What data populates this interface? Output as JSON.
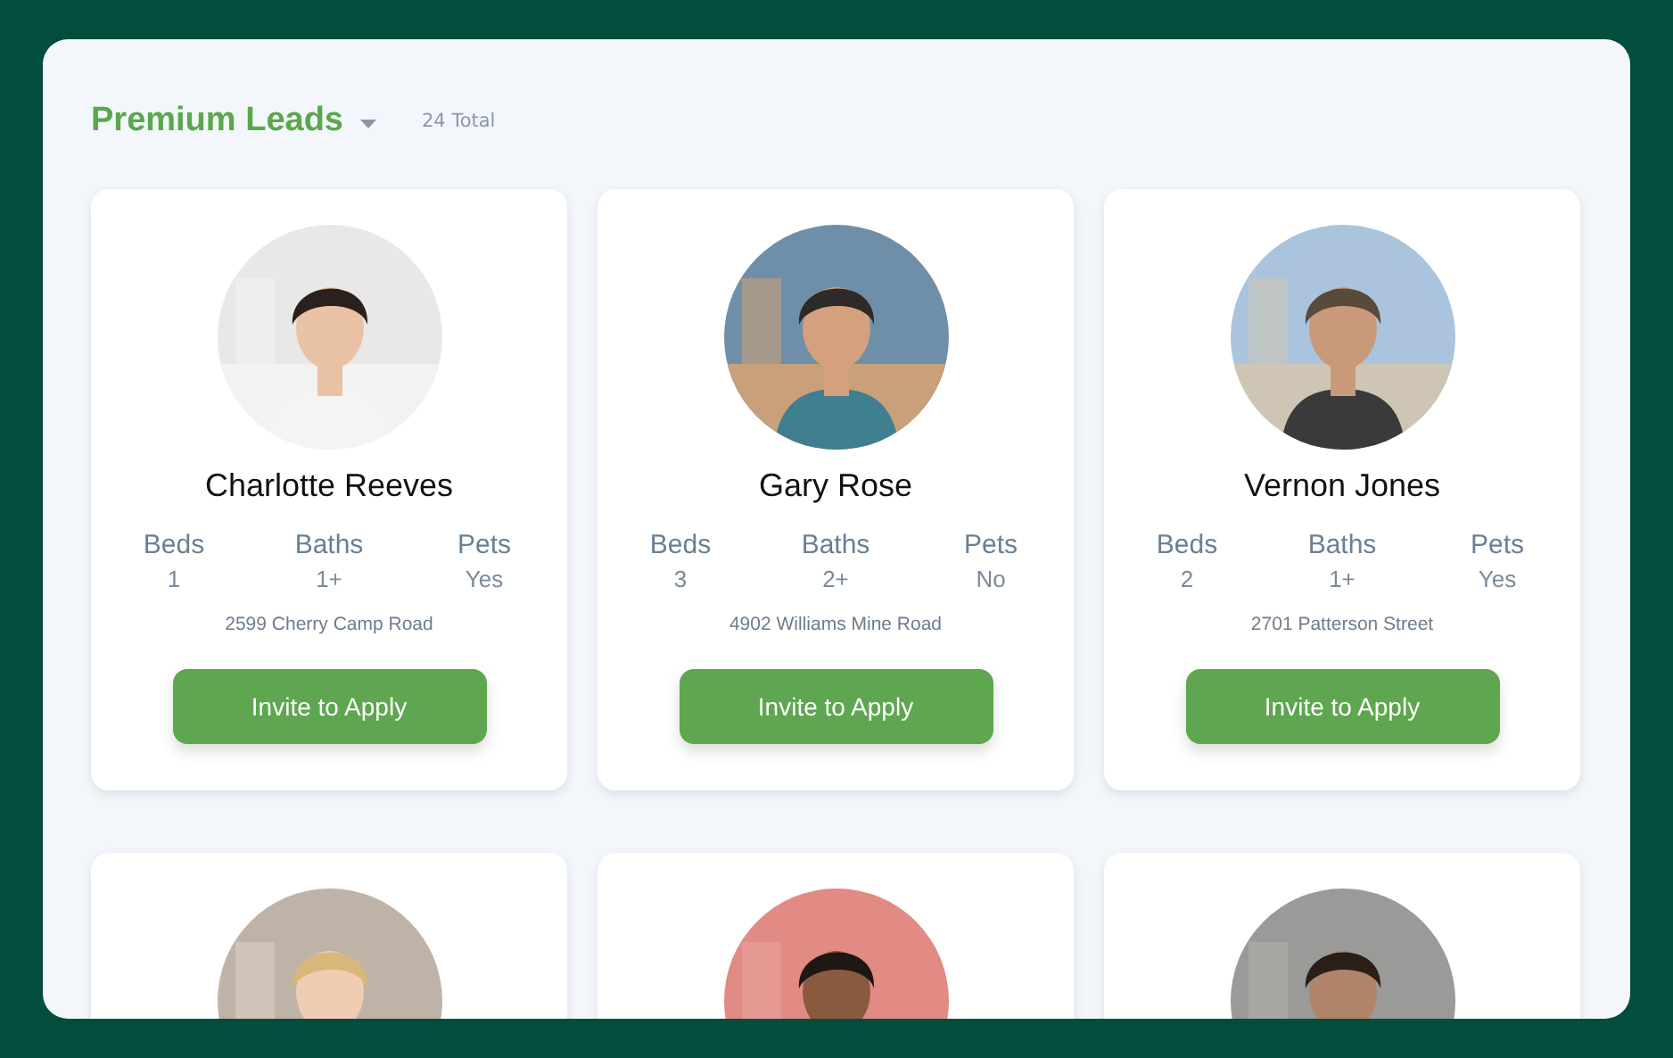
{
  "header": {
    "title": "Premium Leads",
    "total": "24 Total"
  },
  "leads": [
    {
      "photo": {
        "kind": "picture"
      },
      "name": "Charlotte Reeves",
      "stats": [
        {
          "label": "Beds",
          "value": "1"
        },
        {
          "label": "Baths",
          "value": "1+"
        },
        {
          "label": "Pets",
          "value": "Yes"
        }
      ],
      "address": "2599 Cherry Camp Road",
      "button": "Invite to Apply"
    },
    {
      "photo": {
        "kind": "picture"
      },
      "name": "Gary Rose",
      "stats": [
        {
          "label": "Beds",
          "value": "3"
        },
        {
          "label": "Baths",
          "value": "2+"
        },
        {
          "label": "Pets",
          "value": "No"
        }
      ],
      "address": "4902 Williams Mine Road",
      "button": "Invite to Apply"
    },
    {
      "photo": {
        "kind": "picture"
      },
      "name": "Vernon Jones",
      "stats": [
        {
          "label": "Beds",
          "value": "2"
        },
        {
          "label": "Baths",
          "value": "1+"
        },
        {
          "label": "Pets",
          "value": "Yes"
        }
      ],
      "address": "2701 Patterson Street",
      "button": "Invite to Apply"
    },
    {
      "photo": {
        "kind": "picture"
      }
    },
    {
      "photo": {
        "kind": "picture"
      }
    },
    {
      "photo": {
        "kind": "picture"
      }
    }
  ]
}
